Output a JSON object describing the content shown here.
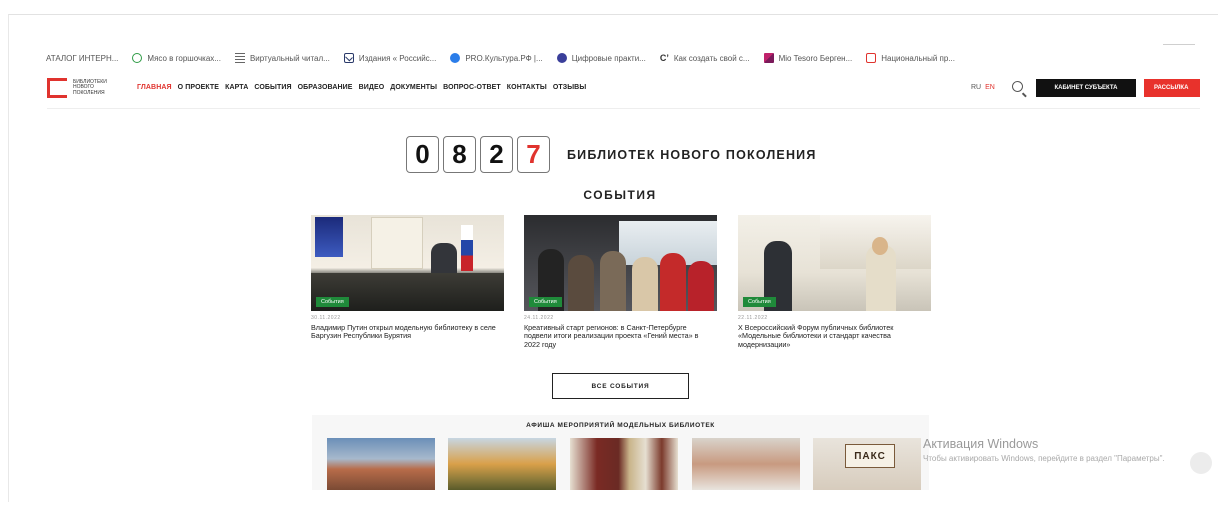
{
  "bookmarks": [
    {
      "label": "АТАЛОГ ИНТЕРН...",
      "icon": "none"
    },
    {
      "label": "Мясо в горшочках...",
      "icon": "green-circle-icon"
    },
    {
      "label": "Виртуальный читал...",
      "icon": "lines-icon"
    },
    {
      "label": "Издания « Российс...",
      "icon": "mail-icon"
    },
    {
      "label": "PRO.Культура.РФ |...",
      "icon": "pro-kultura-icon"
    },
    {
      "label": "Цифровые практи...",
      "icon": "navy-circle-icon"
    },
    {
      "label": "Как создать свой с...",
      "icon": "g-letter-icon"
    },
    {
      "label": "Mio Tesoro Берген...",
      "icon": "pink-flag-icon"
    },
    {
      "label": "Национальный пр...",
      "icon": "red-square-icon"
    }
  ],
  "header": {
    "logo_text": "БИБЛИОТЕКИ НОВОГО ПОКОЛЕНИЯ",
    "nav": [
      "ГЛАВНАЯ",
      "О ПРОЕКТЕ",
      "КАРТА",
      "СОБЫТИЯ",
      "ОБРАЗОВАНИЕ",
      "ВИДЕО",
      "ДОКУМЕНТЫ",
      "ВОПРОС-ОТВЕТ",
      "КОНТАКТЫ",
      "ОТЗЫВЫ"
    ],
    "active_nav": "ГЛАВНАЯ",
    "lang_ru": "RU",
    "lang_en": "EN",
    "cabinet_button": "КАБИНЕТ СУБЪЕКТА",
    "news_button": "РАССЫЛКА",
    "accent_color": "#e0332e"
  },
  "counter": {
    "digits": [
      "0",
      "8",
      "2",
      "7"
    ],
    "label": "БИБЛИОТЕК НОВОГО ПОКОЛЕНИЯ"
  },
  "events": {
    "title": "СОБЫТИЯ",
    "items": [
      {
        "tag": "События",
        "date": "30.11.2022",
        "title": "Владимир Путин открыл модельную библиотеку в селе Баргузин Республики Бурятия"
      },
      {
        "tag": "События",
        "date": "24.11.2022",
        "title": "Креативный старт регионов: в Санкт-Петербурге подвели итоги реализации проекта «Гений места» в 2022 году"
      },
      {
        "tag": "События",
        "date": "22.11.2022",
        "title": "X Всероссийский Форум публичных библиотек «Модельные библиотеки и стандарт качества модернизации»"
      }
    ],
    "all_button": "ВСЕ СОБЫТИЯ"
  },
  "afisha": {
    "title": "АФИША МЕРОПРИЯТИЙ МОДЕЛЬНЫХ БИБЛИОТЕК",
    "thumb_text": "ПАКС"
  },
  "windows": {
    "title": "Активация Windows",
    "subtitle": "Чтобы активировать Windows, перейдите в раздел \"Параметры\"."
  }
}
